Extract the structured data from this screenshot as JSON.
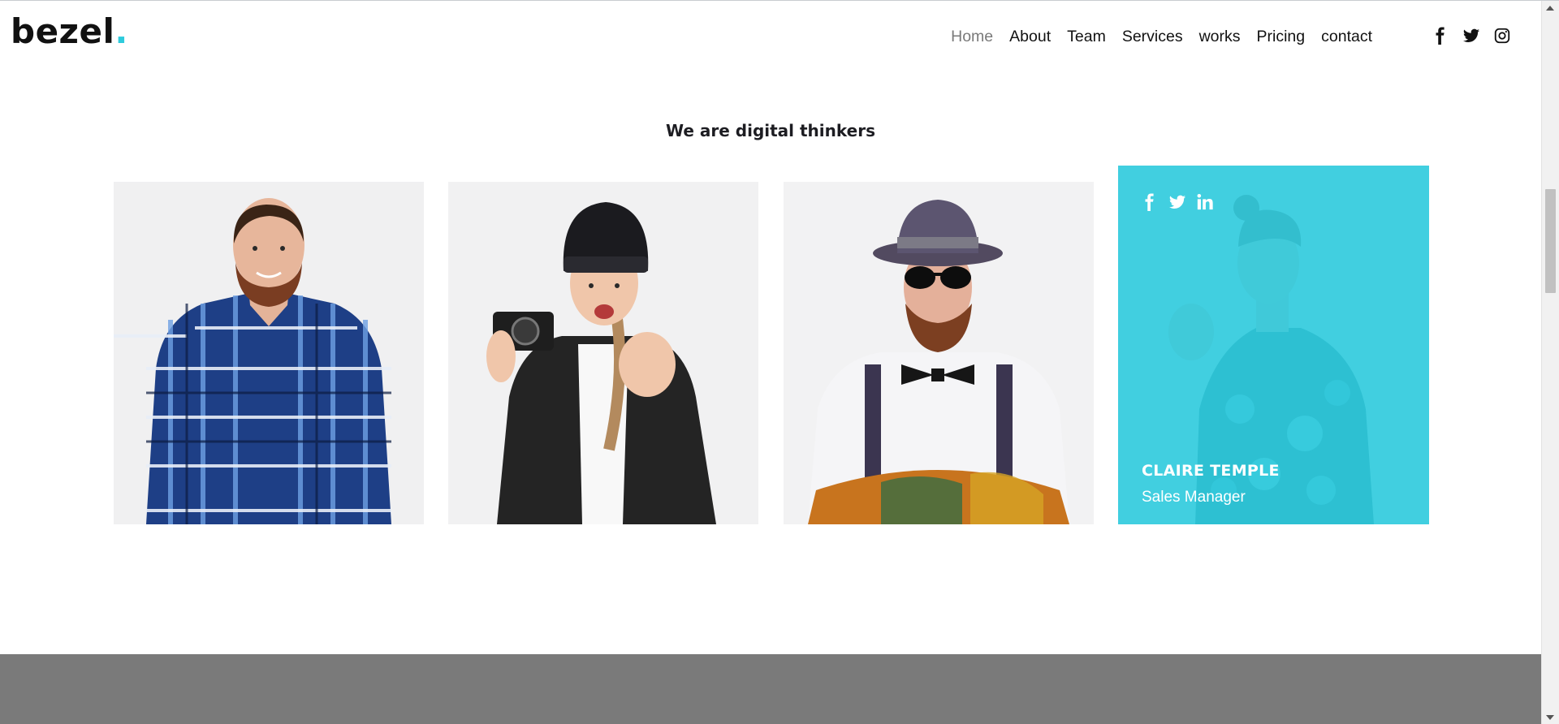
{
  "brand": {
    "name": "bezel",
    "dot": ".",
    "accent_color": "#2ecbdc"
  },
  "nav": {
    "items": [
      {
        "label": "Home",
        "active": true
      },
      {
        "label": "About",
        "active": false
      },
      {
        "label": "Team",
        "active": false
      },
      {
        "label": "Services",
        "active": false
      },
      {
        "label": "works",
        "active": false
      },
      {
        "label": "Pricing",
        "active": false
      },
      {
        "label": "contact",
        "active": false
      }
    ]
  },
  "header_social": [
    "facebook-icon",
    "twitter-icon",
    "instagram-icon"
  ],
  "team_section": {
    "title": "We are digital thinkers",
    "members": [
      {
        "photo": "man in blue plaid shirt"
      },
      {
        "photo": "woman with beanie holding camera"
      },
      {
        "photo": "man with hat, sunglasses and bow tie"
      },
      {
        "photo": "woman in floral top",
        "name": "CLAIRE TEMPLE",
        "role": "Sales Manager",
        "social": [
          "facebook-icon",
          "twitter-icon",
          "linkedin-icon"
        ],
        "hovered": true
      }
    ]
  },
  "colors": {
    "overlay": "#2ecbdc",
    "footer_band": "#7a7a7a",
    "text_dark": "#111111",
    "nav_active": "#7a7a7a"
  }
}
